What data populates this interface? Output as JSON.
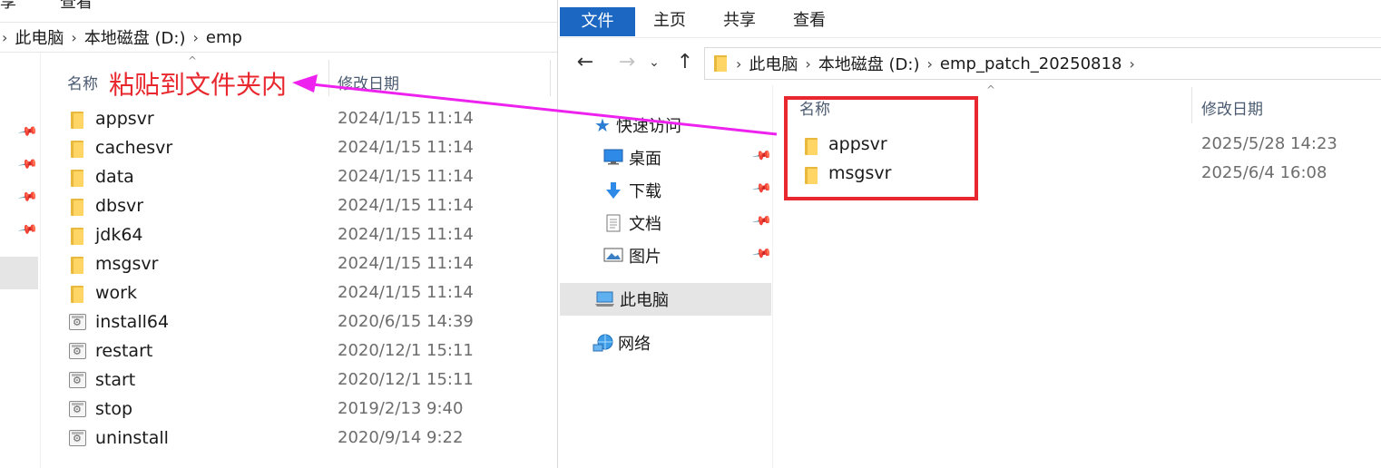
{
  "left_window": {
    "ribbon_partial": [
      "享",
      "查看"
    ],
    "breadcrumb": [
      "此电脑",
      "本地磁盘 (D:)",
      "emp"
    ],
    "columns": {
      "name": "名称",
      "date": "修改日期"
    },
    "annotation": "粘贴到文件夹内",
    "files": [
      {
        "name": "appsvr",
        "date": "2024/1/15 11:14",
        "type": "folder"
      },
      {
        "name": "cachesvr",
        "date": "2024/1/15 11:14",
        "type": "folder"
      },
      {
        "name": "data",
        "date": "2024/1/15 11:14",
        "type": "folder"
      },
      {
        "name": "dbsvr",
        "date": "2024/1/15 11:14",
        "type": "folder"
      },
      {
        "name": "jdk64",
        "date": "2024/1/15 11:14",
        "type": "folder"
      },
      {
        "name": "msgsvr",
        "date": "2024/1/15 11:14",
        "type": "folder"
      },
      {
        "name": "work",
        "date": "2024/1/15 11:14",
        "type": "folder"
      },
      {
        "name": "install64",
        "date": "2020/6/15 14:39",
        "type": "script"
      },
      {
        "name": "restart",
        "date": "2020/12/1 15:11",
        "type": "script"
      },
      {
        "name": "start",
        "date": "2020/12/1 15:11",
        "type": "script"
      },
      {
        "name": "stop",
        "date": "2019/2/13 9:40",
        "type": "script"
      },
      {
        "name": "uninstall",
        "date": "2020/9/14 9:22",
        "type": "script"
      }
    ]
  },
  "right_window": {
    "ribbon_tabs": [
      "文件",
      "主页",
      "共享",
      "查看"
    ],
    "breadcrumb": [
      "此电脑",
      "本地磁盘 (D:)",
      "emp_patch_20250818"
    ],
    "nav": {
      "quick_access": "快速访问",
      "desktop": "桌面",
      "downloads": "下载",
      "documents": "文档",
      "pictures": "图片",
      "this_pc": "此电脑",
      "network": "网络"
    },
    "columns": {
      "name": "名称",
      "date": "修改日期"
    },
    "files": [
      {
        "name": "appsvr",
        "date": "2025/5/28 14:23",
        "type": "folder"
      },
      {
        "name": "msgsvr",
        "date": "2025/6/4 16:08",
        "type": "folder"
      }
    ]
  },
  "colors": {
    "accent": "#1b67c1",
    "annotation_red": "#e8282e",
    "arrow_magenta": "#ee22ee",
    "folder_yellow": "#ffd666"
  }
}
